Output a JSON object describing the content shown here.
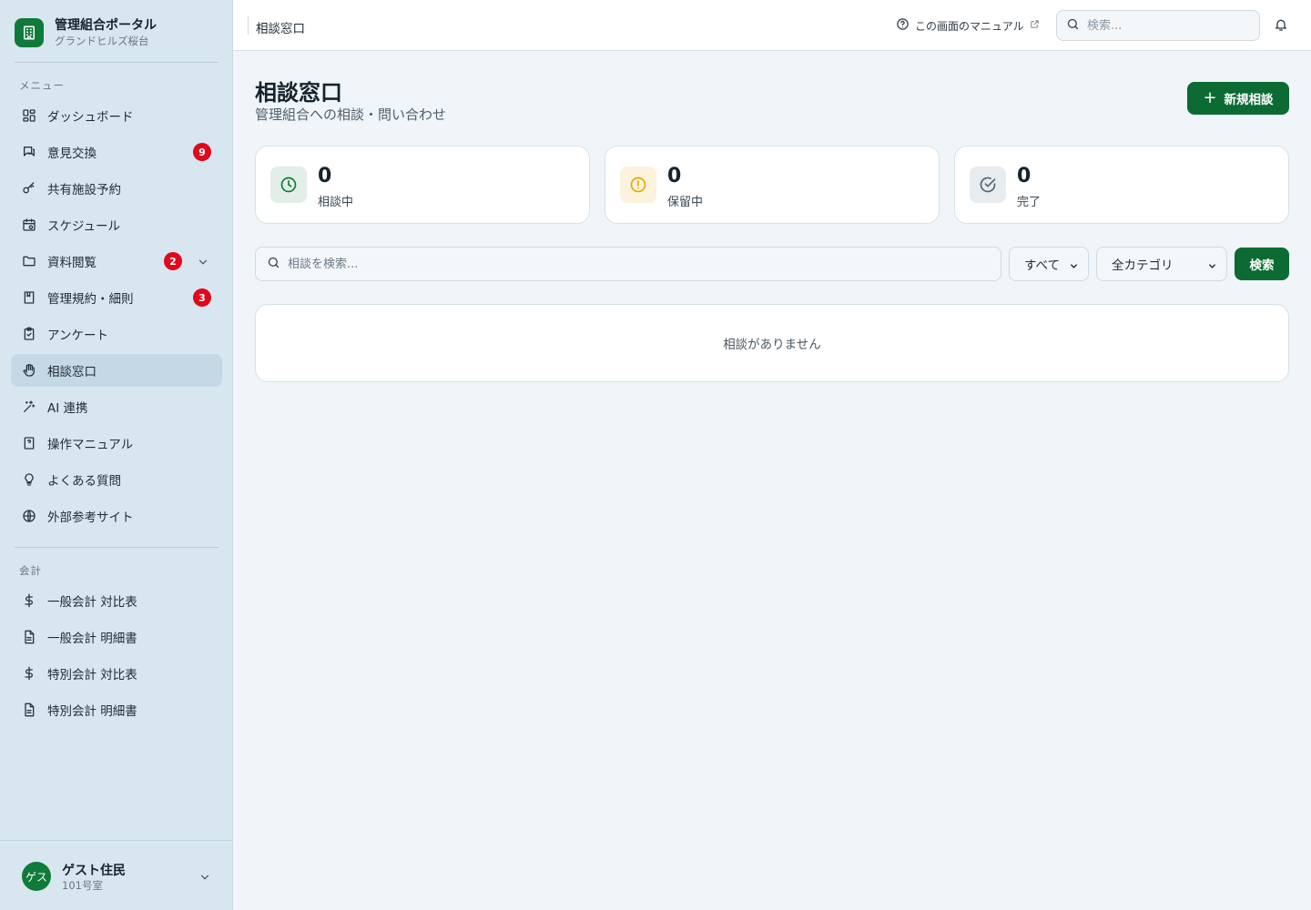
{
  "brand": {
    "title": "管理組合ポータル",
    "subtitle": "グランドヒルズ桜台"
  },
  "sidebar": {
    "menu_heading": "メニュー",
    "items": [
      {
        "label": "ダッシュボード",
        "icon": "dashboard-icon"
      },
      {
        "label": "意見交換",
        "icon": "chat-icon",
        "badge": "9"
      },
      {
        "label": "共有施設予約",
        "icon": "key-icon"
      },
      {
        "label": "スケジュール",
        "icon": "calendar-icon"
      },
      {
        "label": "資料閲覧",
        "icon": "folder-icon",
        "badge": "2",
        "expandable": true
      },
      {
        "label": "管理規約・細則",
        "icon": "book-icon",
        "badge": "3"
      },
      {
        "label": "アンケート",
        "icon": "clipboard-icon"
      },
      {
        "label": "相談窓口",
        "icon": "hand-icon",
        "active": true
      },
      {
        "label": "AI 連携",
        "icon": "sparkle-icon"
      },
      {
        "label": "操作マニュアル",
        "icon": "manual-icon"
      },
      {
        "label": "よくある質問",
        "icon": "lightbulb-icon"
      },
      {
        "label": "外部参考サイト",
        "icon": "globe-icon"
      }
    ],
    "accounting_heading": "会計",
    "accounting_items": [
      {
        "label": "一般会計 対比表",
        "icon": "dollar-icon"
      },
      {
        "label": "一般会計 明細書",
        "icon": "document-icon"
      },
      {
        "label": "特別会計 対比表",
        "icon": "dollar-icon"
      },
      {
        "label": "特別会計 明細書",
        "icon": "document-icon"
      }
    ]
  },
  "user": {
    "avatar_text": "ゲス",
    "name": "ゲスト住民",
    "room": "101号室"
  },
  "header": {
    "title": "相談窓口",
    "manual_link": "この画面のマニュアル",
    "search_placeholder": "検索..."
  },
  "main": {
    "title": "相談窓口",
    "subtitle": "管理組合への相談・問い合わせ",
    "new_button": "新規相談",
    "stats": [
      {
        "value": "0",
        "label": "相談中",
        "icon": "clock-icon",
        "color": "#0f7a3a"
      },
      {
        "value": "0",
        "label": "保留中",
        "icon": "alert-icon",
        "color": "#e2a900"
      },
      {
        "value": "0",
        "label": "完了",
        "icon": "check-circle-icon",
        "color": "#55626d"
      }
    ],
    "search_placeholder": "相談を検索...",
    "status_filter": "すべて",
    "category_filter": "全カテゴリ",
    "search_button": "検索",
    "empty_message": "相談がありません"
  },
  "colors": {
    "accent": "#0b6b33",
    "badge": "#e0081c",
    "sidebar_bg": "#d8e6f0",
    "active_item": "#c4d8e6"
  }
}
